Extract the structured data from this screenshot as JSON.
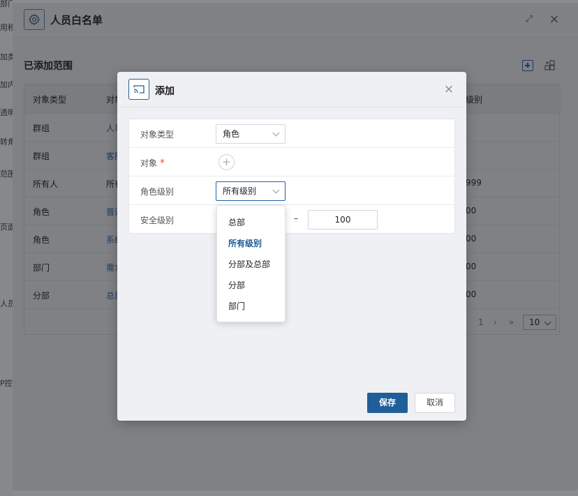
{
  "background": {
    "side_fragments": [
      "部门拼成",
      "用移",
      "加类",
      "加内",
      "透明",
      "转角",
      "范围",
      "页面",
      "人员",
      "P控"
    ]
  },
  "panel": {
    "title": "人员白名单",
    "section_title": "已添加范围",
    "table": {
      "headers": [
        "对象类型",
        "对象",
        "级别"
      ],
      "rows": [
        {
          "type": "群组",
          "object": "人事",
          "level": ""
        },
        {
          "type": "群组",
          "object": "客服",
          "level": ""
        },
        {
          "type": "所有人",
          "object": "所有",
          "level": "999"
        },
        {
          "type": "角色",
          "object": "普通",
          "level": "00"
        },
        {
          "type": "角色",
          "object": "系统",
          "level": "00"
        },
        {
          "type": "部门",
          "object": "需求",
          "level": "00"
        },
        {
          "type": "分部",
          "object": "总部",
          "level": "00"
        }
      ],
      "pager": {
        "page_fragment": "1",
        "next": "›",
        "last": "»",
        "page_size": "10"
      }
    }
  },
  "modal": {
    "title": "添加",
    "fields": {
      "object_type_label": "对象类型",
      "object_type_value": "角色",
      "object_label": "对象",
      "required_mark": "*",
      "add_symbol": "+",
      "role_level_label": "角色级别",
      "role_level_value": "所有级别",
      "security_level_label": "安全级别",
      "range_dash": "–",
      "security_level_max": "100"
    },
    "dropdown_options": [
      "总部",
      "所有级别",
      "分部及总部",
      "分部",
      "部门"
    ],
    "dropdown_selected_index": 1,
    "buttons": {
      "save": "保存",
      "cancel": "取消"
    },
    "close_symbol": "×"
  },
  "colors": {
    "primary": "#1f5e99",
    "required": "#e4553f",
    "overlay": "#7f8184"
  }
}
